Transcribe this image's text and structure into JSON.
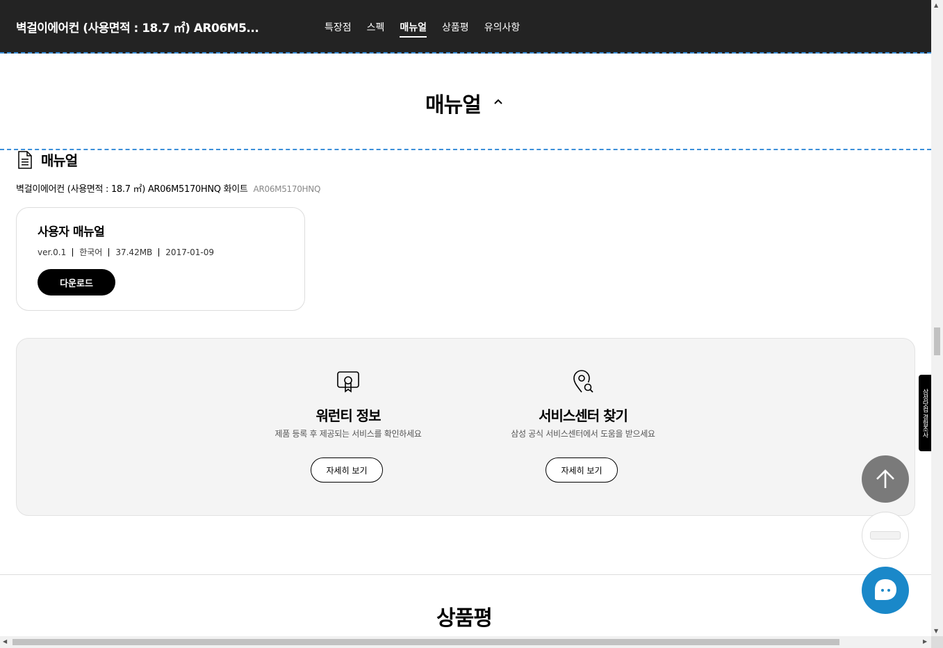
{
  "topbar": {
    "title": "벽걸이에어컨 (사용면적 : 18.7 ㎡) AR06M5...",
    "nav": [
      "특장점",
      "스펙",
      "매뉴얼",
      "상품평",
      "유의사항"
    ],
    "active_index": 2
  },
  "section": {
    "title": "매뉴얼"
  },
  "manual": {
    "label": "매뉴얼",
    "product_name": "벽걸이에어컨 (사용면적 : 18.7 ㎡) AR06M5170HNQ 화이트",
    "product_code": "AR06M5170HNQ",
    "card": {
      "title": "사용자 매뉴얼",
      "version": "ver.0.1",
      "language": "한국어",
      "size": "37.42MB",
      "date": "2017-01-09",
      "download_label": "다운로드"
    }
  },
  "services": [
    {
      "icon": "warranty-certificate-icon",
      "title": "워런티 정보",
      "desc": "제품 등록 후 제공되는 서비스를 확인하세요",
      "button": "자세히 보기"
    },
    {
      "icon": "location-search-icon",
      "title": "서비스센터 찾기",
      "desc": "삼성 공식 서비스센터에서 도움을 받으세요",
      "button": "자세히 보기"
    }
  ],
  "reviews": {
    "title": "상품평"
  },
  "floating": {
    "survey_label": "삼성닷컴 경험조사"
  },
  "colors": {
    "topbar_bg": "#232323",
    "accent_dashed": "#3b8fd9",
    "chat_button": "#1a88c9",
    "top_button": "#7a7a7a"
  }
}
